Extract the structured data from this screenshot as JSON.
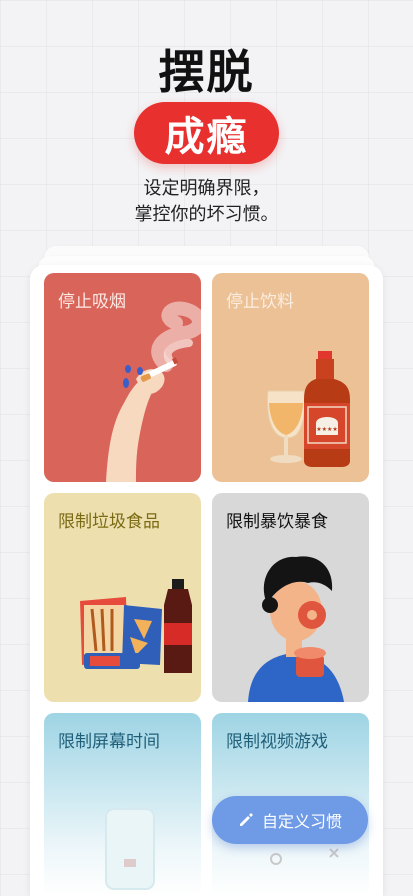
{
  "header": {
    "title": "摆脱",
    "highlight": "成瘾",
    "subtitle_line1": "设定明确界限，",
    "subtitle_line2": "掌控你的坏习惯。"
  },
  "habits": [
    {
      "label": "停止吸烟",
      "icon": "cigarette-hand-icon",
      "color": "#d9645a"
    },
    {
      "label": "停止饮料",
      "icon": "liquor-bottle-icon",
      "color": "#ecc196"
    },
    {
      "label": "限制垃圾食品",
      "icon": "junk-food-icon",
      "color": "#ede0ae"
    },
    {
      "label": "限制暴饮暴食",
      "icon": "overeating-person-icon",
      "color": "#d8d8d8"
    },
    {
      "label": "限制屏幕时间",
      "icon": "phone-icon",
      "color": "#9ed4e4"
    },
    {
      "label": "限制视频游戏",
      "icon": "gamepad-icon",
      "color": "#9ed4e4"
    }
  ],
  "fab": {
    "label": "自定义习惯",
    "icon": "pencil-icon",
    "color": "#6e9ae6"
  },
  "accent_color": "#e8302f"
}
